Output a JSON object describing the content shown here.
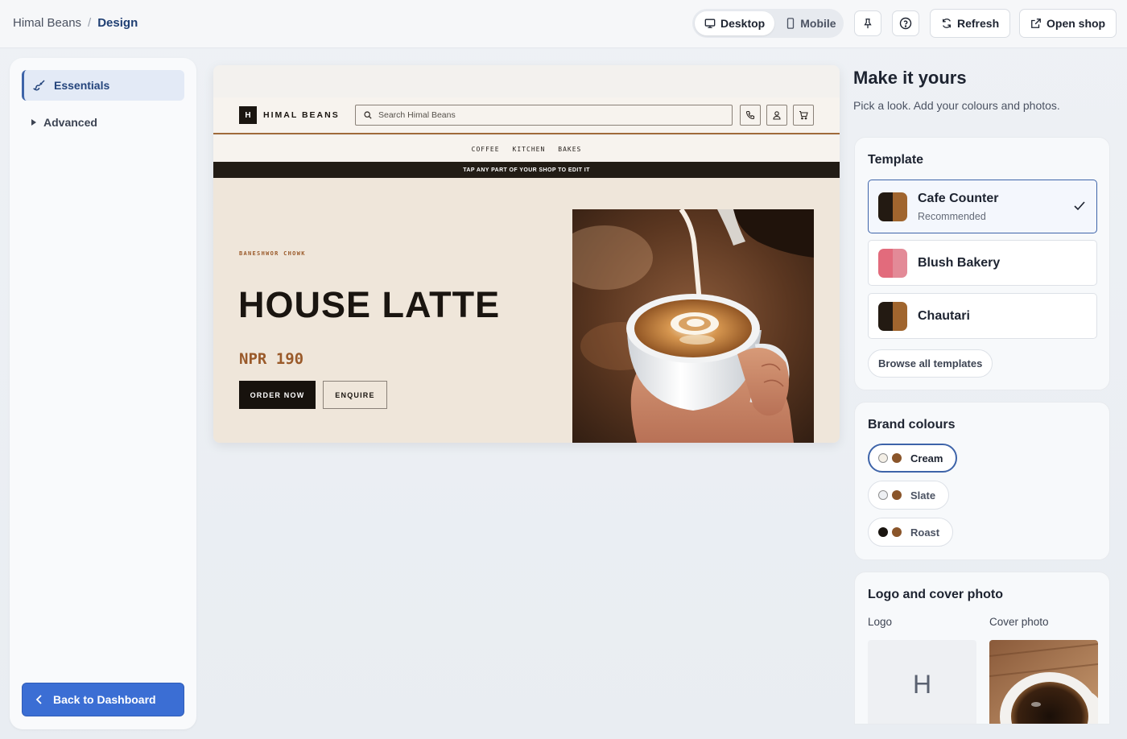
{
  "breadcrumb": {
    "parent": "Himal Beans",
    "separator": "/",
    "current": "Design"
  },
  "toolbar": {
    "view_modes": [
      {
        "label": "Desktop",
        "icon": "monitor-icon",
        "active": true
      },
      {
        "label": "Mobile",
        "icon": "smartphone-icon",
        "active": false
      }
    ],
    "pin_icon": "pin-icon",
    "help_icon": "help-circle-icon",
    "refresh_label": "Refresh",
    "open_shop_label": "Open shop"
  },
  "sidebar": {
    "active_item": "Essentials",
    "collapsed_item": "Advanced",
    "back_label": "Back to Dashboard"
  },
  "preview": {
    "logo_letter": "H",
    "brand": "HIMAL BEANS",
    "search_placeholder": "Search Himal Beans",
    "nav": [
      "COFFEE",
      "KITCHEN",
      "BAKES"
    ],
    "ribbon": "TAP ANY PART OF YOUR SHOP TO EDIT IT",
    "location": "BANESHWOR CHOWK",
    "product": "HOUSE LATTE",
    "price": "NPR 190",
    "primary_cta": "ORDER NOW",
    "secondary_cta": "ENQUIRE"
  },
  "panel": {
    "title": "Make it yours",
    "subtitle": "Pick a look. Add your colours and photos.",
    "template_heading": "Template",
    "templates": [
      {
        "name": "Cafe Counter",
        "tag": "Recommended",
        "selected": true,
        "colors": [
          "#231a12",
          "#a0652e"
        ]
      },
      {
        "name": "Blush Bakery",
        "tag": "",
        "selected": false,
        "colors": [
          "#e26b7c",
          "#e38a97"
        ]
      },
      {
        "name": "Chautari",
        "tag": "",
        "selected": false,
        "colors": [
          "#231a12",
          "#a0652e"
        ]
      }
    ],
    "browse_label": "Browse all templates",
    "colours_heading": "Brand colours",
    "palettes": [
      {
        "name": "Cream",
        "selected": true,
        "colors": [
          "#f4efe6",
          "#8a552a"
        ]
      },
      {
        "name": "Slate",
        "selected": false,
        "colors": [
          "#eef0f3",
          "#8a552a"
        ]
      },
      {
        "name": "Roast",
        "selected": false,
        "colors": [
          "#1a1510",
          "#8a552a"
        ]
      }
    ],
    "media_heading": "Logo and cover photo",
    "logo_label": "Logo",
    "cover_label": "Cover photo",
    "logo_letter": "H"
  }
}
